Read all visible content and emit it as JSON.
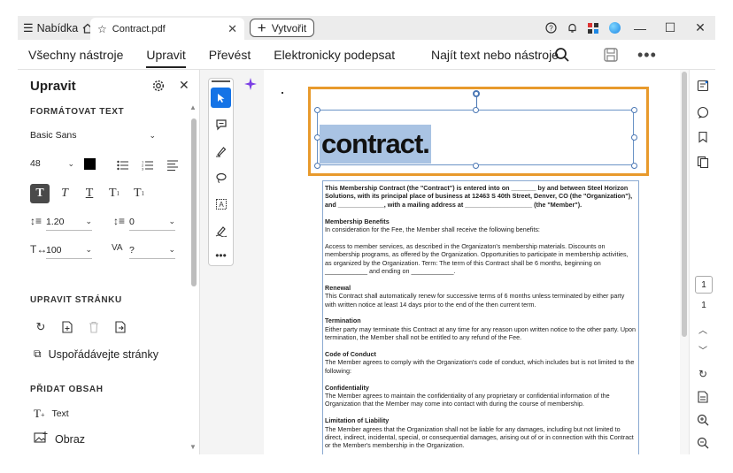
{
  "titlebar": {
    "menu_label": "Nabídka",
    "tab_title": "Contract.pdf",
    "create_label": "Vytvořit",
    "help_icon": "help-icon",
    "bell_icon": "bell-icon",
    "apps_icon": "apps-icon"
  },
  "menubar": {
    "items": [
      {
        "label": "Všechny nástroje"
      },
      {
        "label": "Upravit"
      },
      {
        "label": "Převést"
      },
      {
        "label": "Elektronicky podepsat"
      }
    ],
    "search_label": "Najít text nebo nástroje"
  },
  "left_panel": {
    "title": "Upravit",
    "format_section": "FORMÁTOVAT TEXT",
    "font_family": "Basic Sans",
    "font_size": "48",
    "text_color": "#000000",
    "line_spacing": "1.20",
    "paragraph_spacing": "0",
    "horizontal_scale": "100",
    "char_spacing": "?",
    "page_section": "UPRAVIT STRÁNKU",
    "organize_label": "Uspořádávejte stránky",
    "add_section": "PŘIDAT OBSAH",
    "add_text_label": "Text",
    "add_image_label": "Obraz"
  },
  "document": {
    "heading_word": "contract.",
    "intro": "This Membership Contract (the \"Contract\") is entered into on _______ by and between Steel Horizon Solutions, with its principal place of business at 12463 S 40th Street, Denver, CO (the \"Organization\"), and _____________, with a mailing address at ___________________ (the \"Member\").",
    "sections": [
      {
        "heading": "Membership Benefits",
        "body": "In consideration for the Fee, the Member shall receive the following benefits:"
      },
      {
        "heading": "",
        "body": "Access to member services, as described in the Organizaton's membership materials. Discounts on membership programs, as offered by the Organization. Opportunities to participate in membership activities, as organized by the Organization. Term: The term of this Contract shall be 6 months, beginning on ____________ and ending on ____________."
      },
      {
        "heading": "Renewal",
        "body": "This Contract shall automatically renew for successive terms of 6 months unless terminated by either party with written notice at least 14 days prior to the end of the then current term."
      },
      {
        "heading": "Termination",
        "body": "Either party may terminate this Contract at any time for any reason upon written notice to the other party. Upon termination, the Member shall not be entitled to any refund of the Fee."
      },
      {
        "heading": "Code of Conduct",
        "body": "The Member agrees to comply with the Organization's code of conduct, which includes but is not limited to the following:"
      },
      {
        "heading": "Confidentiality",
        "body": "The Member agrees to maintain the confidentiality of any proprietary or confidential information of the Organization that the Member may come into contact with during the course of membership."
      },
      {
        "heading": "Limitation of Liability",
        "body": "The Member agrees that the Organization shall not be liable for any damages, including but not limited to direct, indirect, incidental, special, or consequential damages, arising out of or in connection with this Contract or the Member's membership in the Organization."
      }
    ]
  },
  "right_bar": {
    "current_page": "1",
    "total_pages": "1"
  },
  "colors": {
    "accent": "#1473e6",
    "selection_frame": "#e89a2c",
    "text_highlight": "#a9c3e3"
  }
}
